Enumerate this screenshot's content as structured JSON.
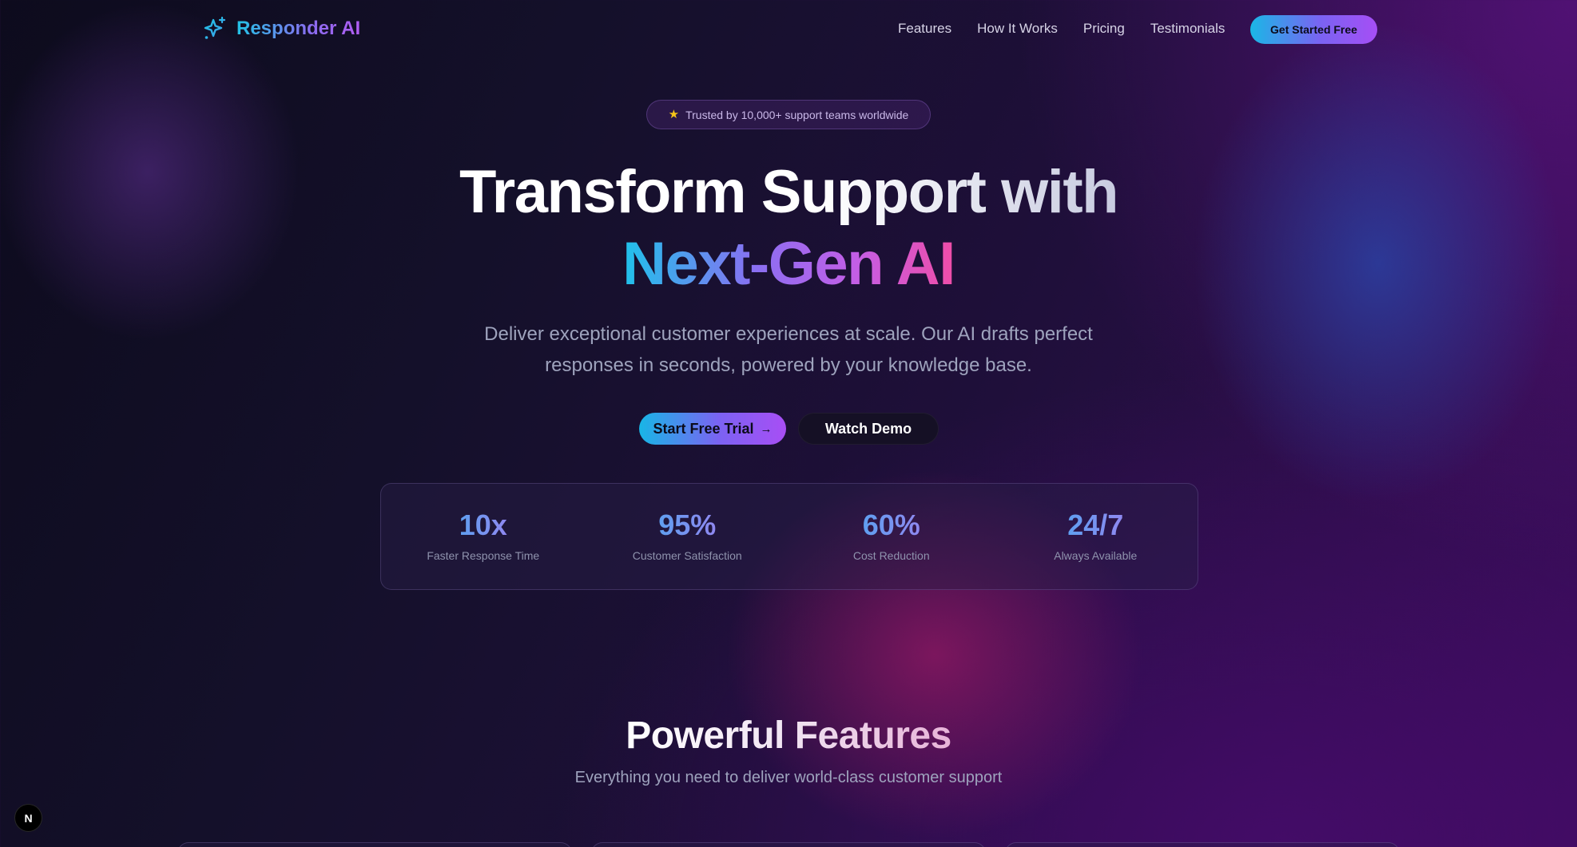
{
  "nav": {
    "brand_name": "Responder AI",
    "brand_icon": "sparkles-icon",
    "links": [
      "Features",
      "How It Works",
      "Pricing",
      "Testimonials"
    ],
    "cta_label": "Get Started Free"
  },
  "hero": {
    "badge_icon": "star-icon",
    "badge_text": "Trusted by 10,000+ support teams worldwide",
    "title_line1": "Transform Support with",
    "title_line2": "Next-Gen AI",
    "subtitle": "Deliver exceptional customer experiences at scale. Our AI drafts perfect responses in seconds, powered by your knowledge base.",
    "primary_button": "Start Free Trial",
    "primary_button_icon": "arrow-right-icon",
    "secondary_button": "Watch Demo"
  },
  "stats": [
    {
      "value": "10x",
      "label": "Faster Response Time"
    },
    {
      "value": "95%",
      "label": "Customer Satisfaction"
    },
    {
      "value": "60%",
      "label": "Cost Reduction"
    },
    {
      "value": "24/7",
      "label": "Always Available"
    }
  ],
  "features": {
    "title": "Powerful Features",
    "subtitle": "Everything you need to deliver world-class customer support"
  },
  "dev_indicator": {
    "label": "N"
  },
  "colors": {
    "accent_cyan": "#22c3e6",
    "accent_violet": "#8a6cf0",
    "accent_pink": "#ef4da8",
    "background": "#14102a"
  }
}
